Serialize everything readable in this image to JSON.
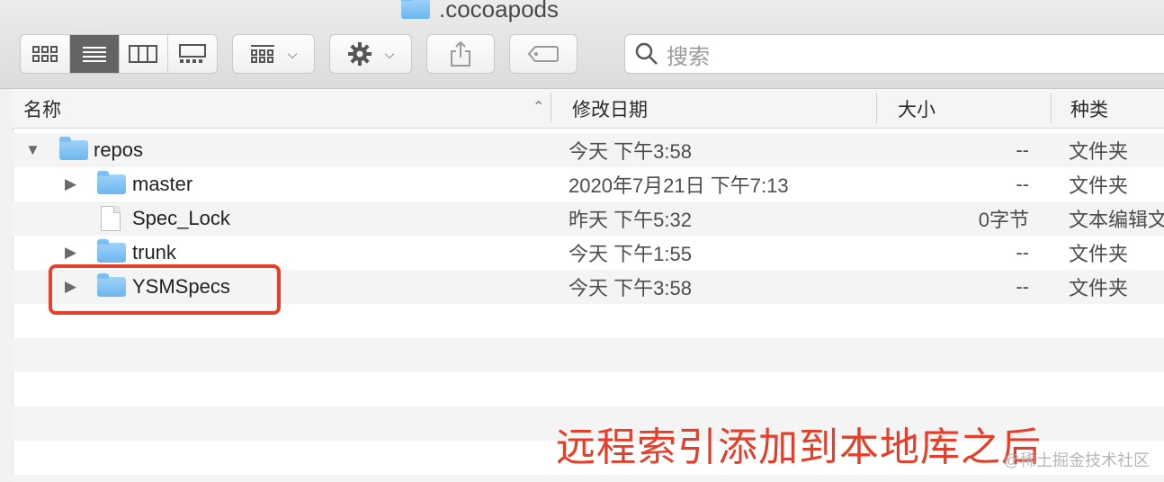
{
  "window": {
    "title": ".cocoapods"
  },
  "toolbar": {
    "view_modes": [
      {
        "name": "icon-view",
        "icon": "grid-icon",
        "active": false
      },
      {
        "name": "list-view",
        "icon": "list-icon",
        "active": true
      },
      {
        "name": "column-view",
        "icon": "columns-icon",
        "active": false
      },
      {
        "name": "gallery-view",
        "icon": "gallery-icon",
        "active": false
      }
    ],
    "group_icon": "group-grid-icon",
    "action_icon": "gear-icon",
    "share_icon": "share-icon",
    "tag_icon": "tag-icon",
    "search_placeholder": "搜索"
  },
  "columns": {
    "name": "名称",
    "date": "修改日期",
    "size": "大小",
    "kind": "种类"
  },
  "rows": [
    {
      "name": "repos",
      "type": "folder",
      "expanded": true,
      "indent": 0,
      "date": "今天 下午3:58",
      "size": "--",
      "kind": "文件夹"
    },
    {
      "name": "master",
      "type": "folder",
      "expanded": false,
      "indent": 1,
      "date": "2020年7月21日 下午7:13",
      "size": "--",
      "kind": "文件夹"
    },
    {
      "name": "Spec_Lock",
      "type": "file",
      "expanded": false,
      "indent": 1,
      "date": "昨天 下午5:32",
      "size": "0字节",
      "kind": "文本编辑文"
    },
    {
      "name": "trunk",
      "type": "folder",
      "expanded": false,
      "indent": 1,
      "date": "今天 下午1:55",
      "size": "--",
      "kind": "文件夹"
    },
    {
      "name": "YSMSpecs",
      "type": "folder",
      "expanded": false,
      "indent": 1,
      "date": "今天 下午3:58",
      "size": "--",
      "kind": "文件夹"
    }
  ],
  "annotation": "远程索引添加到本地库之后",
  "watermark": "@稀土掘金技术社区",
  "colors": {
    "highlight": "#e43f2a",
    "folder": "#7cc0f3",
    "active_segment": "#646464"
  }
}
